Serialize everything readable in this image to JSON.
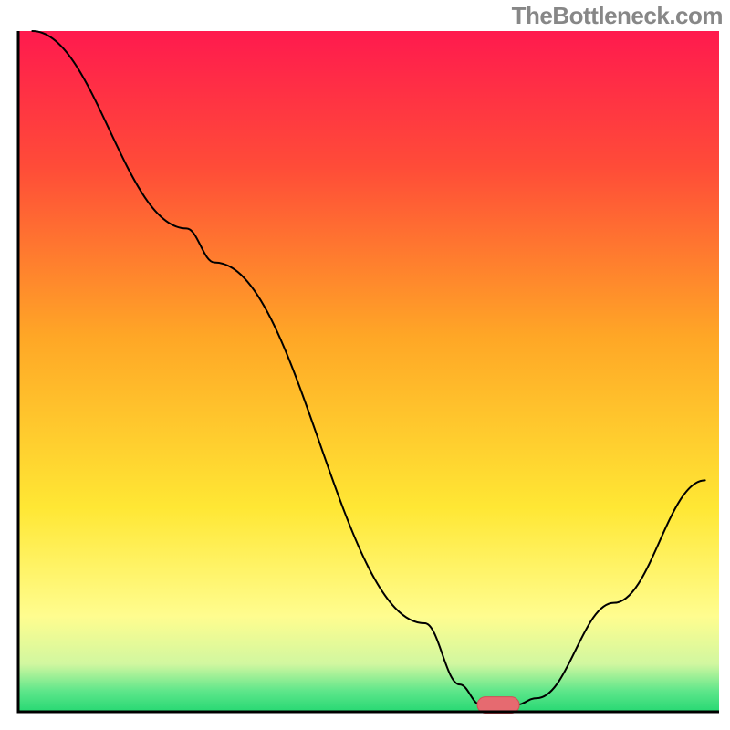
{
  "watermark": "TheBottleneck.com",
  "chart_data": {
    "type": "line",
    "title": "",
    "xlabel": "",
    "ylabel": "",
    "xlim": [
      0,
      100
    ],
    "ylim": [
      0,
      100
    ],
    "background_gradient": {
      "stops": [
        {
          "offset": 0.0,
          "color": "#ff1a4e"
        },
        {
          "offset": 0.2,
          "color": "#ff4c38"
        },
        {
          "offset": 0.45,
          "color": "#ffa726"
        },
        {
          "offset": 0.7,
          "color": "#ffe734"
        },
        {
          "offset": 0.86,
          "color": "#fffd8f"
        },
        {
          "offset": 0.93,
          "color": "#d1f7a0"
        },
        {
          "offset": 0.97,
          "color": "#5de68a"
        },
        {
          "offset": 1.0,
          "color": "#27d873"
        }
      ]
    },
    "series": [
      {
        "name": "bottleneck-curve",
        "color": "#000000",
        "width": 2,
        "points": [
          {
            "x": 2,
            "y": 100
          },
          {
            "x": 24,
            "y": 71
          },
          {
            "x": 28,
            "y": 66
          },
          {
            "x": 58,
            "y": 13
          },
          {
            "x": 63,
            "y": 4
          },
          {
            "x": 66,
            "y": 1
          },
          {
            "x": 71,
            "y": 1
          },
          {
            "x": 74,
            "y": 2
          },
          {
            "x": 85,
            "y": 16
          },
          {
            "x": 98,
            "y": 34
          }
        ]
      }
    ],
    "highlight_marker": {
      "color_fill": "#e66a70",
      "color_stroke": "#d14f56",
      "x_center": 68.5,
      "y": 1,
      "half_width": 3,
      "radius": 1.2
    },
    "axes": {
      "color": "#000000",
      "width": 3
    }
  }
}
